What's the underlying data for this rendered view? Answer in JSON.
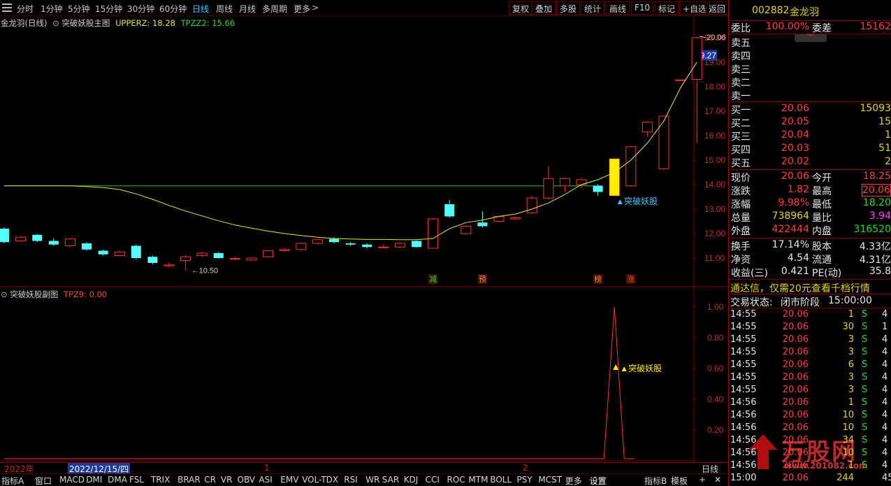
{
  "toolbar": {
    "periods": [
      "分时",
      "1分钟",
      "5分钟",
      "15分钟",
      "30分钟",
      "60分钟",
      "日线",
      "周线",
      "月线",
      "多周期",
      "更多"
    ],
    "active_period": "日线",
    "right_buttons": [
      "复权",
      "叠加",
      "多股",
      "统计",
      "画线",
      "F10",
      "标记",
      "+自选",
      "返回"
    ]
  },
  "main_chart": {
    "stock_title": "金龙羽(日线)",
    "indicator_name": "突破妖股主图",
    "upperz_label": "UPPERZ: 18.28",
    "tpzz2_label": "TPZZ2: 15.66",
    "price_axis": [
      "20.00",
      "19.00",
      "18.00",
      "17.00",
      "16.00",
      "15.00",
      "14.00",
      "13.00",
      "12.00",
      "11.00"
    ],
    "current_price_tag": "19.27",
    "high_label": "20.06",
    "low_label": "10.50",
    "signal_label": "▲突破妖股",
    "markers": [
      {
        "text": "减",
        "color": "#22dd22"
      },
      {
        "text": "预",
        "color": "#ff8030"
      },
      {
        "text": "榜",
        "color": "#ff8030"
      },
      {
        "text": "涨",
        "color": "#ff4040"
      }
    ]
  },
  "chart_data": {
    "type": "candlestick",
    "ylim": [
      10.4,
      20.4
    ],
    "candles": [
      {
        "o": 12.2,
        "c": 11.65,
        "h": 12.25,
        "l": 11.6
      },
      {
        "o": 11.7,
        "c": 11.85,
        "h": 11.9,
        "l": 11.65
      },
      {
        "o": 11.95,
        "c": 11.7,
        "h": 11.98,
        "l": 11.65
      },
      {
        "o": 11.7,
        "c": 11.55,
        "h": 11.8,
        "l": 11.5
      },
      {
        "o": 11.5,
        "c": 11.78,
        "h": 11.82,
        "l": 11.45
      },
      {
        "o": 11.6,
        "c": 11.35,
        "h": 11.65,
        "l": 11.3
      },
      {
        "o": 11.3,
        "c": 11.15,
        "h": 11.35,
        "l": 11.1
      },
      {
        "o": 11.1,
        "c": 11.25,
        "h": 11.3,
        "l": 11.05
      },
      {
        "o": 11.5,
        "c": 11.0,
        "h": 11.55,
        "l": 10.95
      },
      {
        "o": 11.05,
        "c": 10.8,
        "h": 11.1,
        "l": 10.75
      },
      {
        "o": 10.68,
        "c": 10.72,
        "h": 10.82,
        "l": 10.62
      },
      {
        "o": 10.9,
        "c": 11.05,
        "h": 11.12,
        "l": 10.5
      },
      {
        "o": 11.1,
        "c": 11.2,
        "h": 11.25,
        "l": 11.05
      },
      {
        "o": 11.2,
        "c": 11.0,
        "h": 11.25,
        "l": 10.98
      },
      {
        "o": 10.98,
        "c": 10.98,
        "h": 11.05,
        "l": 10.92
      },
      {
        "o": 10.92,
        "c": 11.0,
        "h": 11.05,
        "l": 10.9
      },
      {
        "o": 11.05,
        "c": 11.3,
        "h": 11.32,
        "l": 11.02
      },
      {
        "o": 11.3,
        "c": 11.35,
        "h": 11.4,
        "l": 11.25
      },
      {
        "o": 11.35,
        "c": 11.6,
        "h": 11.62,
        "l": 11.3
      },
      {
        "o": 11.6,
        "c": 11.75,
        "h": 11.78,
        "l": 11.55
      },
      {
        "o": 11.78,
        "c": 11.65,
        "h": 11.85,
        "l": 11.6
      },
      {
        "o": 11.6,
        "c": 11.55,
        "h": 11.65,
        "l": 11.5
      },
      {
        "o": 11.55,
        "c": 11.45,
        "h": 11.6,
        "l": 11.4
      },
      {
        "o": 11.45,
        "c": 11.45,
        "h": 11.55,
        "l": 11.38
      },
      {
        "o": 11.45,
        "c": 11.6,
        "h": 11.65,
        "l": 11.4
      },
      {
        "o": 11.7,
        "c": 11.45,
        "h": 11.72,
        "l": 11.42
      },
      {
        "o": 11.4,
        "c": 12.6,
        "h": 12.65,
        "l": 11.4
      },
      {
        "o": 13.2,
        "c": 12.7,
        "h": 13.38,
        "l": 12.65
      },
      {
        "o": 12.0,
        "c": 12.3,
        "h": 12.35,
        "l": 11.95
      },
      {
        "o": 12.45,
        "c": 12.3,
        "h": 12.9,
        "l": 12.25
      },
      {
        "o": 12.5,
        "c": 12.7,
        "h": 12.75,
        "l": 12.45
      },
      {
        "o": 12.6,
        "c": 12.65,
        "h": 12.7,
        "l": 12.55
      },
      {
        "o": 12.85,
        "c": 13.45,
        "h": 13.55,
        "l": 12.8
      },
      {
        "o": 13.45,
        "c": 14.25,
        "h": 14.75,
        "l": 13.4
      },
      {
        "o": 13.95,
        "c": 14.25,
        "h": 14.3,
        "l": 13.7
      },
      {
        "o": 14.0,
        "c": 14.2,
        "h": 14.28,
        "l": 13.85
      },
      {
        "o": 13.95,
        "c": 13.7,
        "h": 14.02,
        "l": 13.55
      },
      {
        "o": 13.55,
        "c": 15.05,
        "h": 15.05,
        "l": 13.55
      },
      {
        "o": 13.95,
        "c": 15.55,
        "h": 15.58,
        "l": 13.9
      },
      {
        "o": 16.15,
        "c": 16.55,
        "h": 16.58,
        "l": 15.95
      },
      {
        "o": 14.65,
        "c": 16.8,
        "h": 16.82,
        "l": 14.6
      },
      {
        "o": 18.28,
        "c": 18.28,
        "h": 18.28,
        "l": 18.28
      },
      {
        "o": 18.3,
        "c": 20.0,
        "h": 20.06,
        "l": 15.7
      }
    ],
    "ma_series": [
      13.95,
      13.95,
      13.95,
      13.95,
      13.95,
      13.92,
      13.88,
      13.8,
      13.62,
      13.4,
      13.15,
      12.92,
      12.72,
      12.52,
      12.35,
      12.22,
      12.1,
      12.0,
      11.92,
      11.85,
      11.8,
      11.78,
      11.76,
      11.76,
      11.75,
      11.75,
      11.8,
      12.2,
      12.45,
      12.55,
      12.7,
      12.8,
      13.0,
      13.25,
      13.6,
      14.0,
      14.2,
      14.5,
      15.0,
      15.7,
      16.6,
      17.95,
      19.0
    ],
    "flat_line": 13.95
  },
  "sub_chart": {
    "indicator_name": "突破妖股副图",
    "tpz9_label": "TPZ9: 0.00",
    "axis": [
      "1.00",
      "0.80",
      "0.60",
      "0.40",
      "0.20"
    ],
    "signal_label": "▲突破妖股",
    "spike_index": 37
  },
  "time_axis": {
    "year": "2022年",
    "cursor_date": "2022/12/15/四",
    "month1": "1",
    "month2": "2",
    "period_label": "日线"
  },
  "bottom_tabs": [
    "指标A",
    "窗口",
    "MACD",
    "DMI",
    "DMA",
    "FSL",
    "TRIX",
    "BRAR",
    "CR",
    "VR",
    "OBV",
    "ASI",
    "EMV",
    "VOL-TDX",
    "RSI",
    "WR",
    "SAR",
    "KDJ",
    "CCI",
    "ROC",
    "MTM",
    "BOLL",
    "PSY",
    "MCST",
    "更多",
    "设置"
  ],
  "bottom_right_tabs": [
    "指标B",
    "模板"
  ],
  "quote": {
    "code": "002882",
    "name": "金龙羽",
    "weibi_label": "委比",
    "weibi_value": "100.00%",
    "weicha_label": "委差",
    "weicha_value": "15162",
    "sell_labels": [
      "卖五",
      "卖四",
      "卖三",
      "卖二",
      "卖一"
    ],
    "buy": [
      {
        "label": "买一",
        "price": "20.06",
        "vol": "15093"
      },
      {
        "label": "买二",
        "price": "20.05",
        "vol": "15"
      },
      {
        "label": "买三",
        "price": "20.04",
        "vol": "1"
      },
      {
        "label": "买四",
        "price": "20.03",
        "vol": "51"
      },
      {
        "label": "买五",
        "price": "20.02",
        "vol": "2"
      }
    ],
    "stats": [
      {
        "l1": "现价",
        "v1": "20.06",
        "c1": "red",
        "l2": "今开",
        "v2": "18.25",
        "c2": "red"
      },
      {
        "l1": "涨跌",
        "v1": "1.82",
        "c1": "red",
        "l2": "最高",
        "v2": "20.06",
        "c2": "red"
      },
      {
        "l1": "涨幅",
        "v1": "9.98%",
        "c1": "red",
        "l2": "最低",
        "v2": "18.20",
        "c2": "green"
      },
      {
        "l1": "总量",
        "v1": "738964",
        "c1": "yellow",
        "l2": "量比",
        "v2": "3.94",
        "c2": "magenta"
      },
      {
        "l1": "外盘",
        "v1": "422444",
        "c1": "red",
        "l2": "内盘",
        "v2": "316520",
        "c2": "green"
      }
    ],
    "finance": [
      {
        "l1": "换手",
        "v1": "17.14%",
        "l2": "股本",
        "v2": "4.33亿"
      },
      {
        "l1": "净资",
        "v1": "4.54",
        "l2": "流通",
        "v2": "4.31亿"
      },
      {
        "l1": "收益(三)",
        "v1": "0.421",
        "l2": "PE(动)",
        "v2": "35.8"
      }
    ],
    "promo": "通达信，仅需20元查看千档行情",
    "status_label": "交易状态:",
    "status_value": "闭市阶段",
    "status_time": "15:00:00",
    "ticks": [
      {
        "t": "14:55",
        "p": "20.06",
        "v": "1",
        "s": "S"
      },
      {
        "t": "14:55",
        "p": "20.06",
        "v": "30",
        "s": "S"
      },
      {
        "t": "14:55",
        "p": "20.06",
        "v": "3",
        "s": "S"
      },
      {
        "t": "14:55",
        "p": "20.06",
        "v": "3",
        "s": "S"
      },
      {
        "t": "14:55",
        "p": "20.06",
        "v": "6",
        "s": "S"
      },
      {
        "t": "14:55",
        "p": "20.06",
        "v": "3",
        "s": "S"
      },
      {
        "t": "14:55",
        "p": "20.06",
        "v": "3",
        "s": "S"
      },
      {
        "t": "14:56",
        "p": "20.06",
        "v": "1",
        "s": "S"
      },
      {
        "t": "14:56",
        "p": "20.06",
        "v": "10",
        "s": "S"
      },
      {
        "t": "14:56",
        "p": "20.06",
        "v": "10",
        "s": "S"
      },
      {
        "t": "14:56",
        "p": "20.06",
        "v": "34",
        "s": "S"
      },
      {
        "t": "14:56",
        "p": "20.06",
        "v": "10",
        "s": "S"
      },
      {
        "t": "14:56",
        "p": "20.06",
        "v": "1",
        "s": "S"
      },
      {
        "t": "15:00",
        "p": "20.06",
        "v": "244",
        "s": ""
      }
    ],
    "tick_tails": [
      "4",
      "1",
      "4",
      "4",
      "4",
      "4",
      "4",
      "4",
      "4",
      "4",
      "4",
      "4",
      "4",
      "45"
    ]
  },
  "watermark": {
    "brand": "万股网",
    "url": "www.201082.com"
  },
  "colors": {
    "up": "#ff3030",
    "down": "#54ffff",
    "ma": "#e8e830",
    "flat": "#1fbf1f",
    "grid": "#5a0000"
  }
}
